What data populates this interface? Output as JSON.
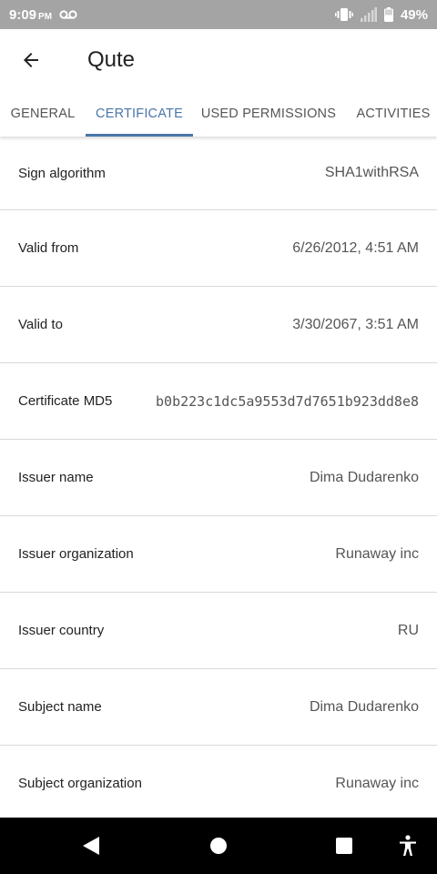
{
  "status_bar": {
    "time": "9:09",
    "ampm": "PM",
    "battery": "49%",
    "icons": [
      "voicemail-icon",
      "vibrate-icon",
      "signal-icon",
      "battery-icon"
    ]
  },
  "app_bar": {
    "title": "Qute",
    "back_icon": "arrow-left-icon"
  },
  "tabs": [
    {
      "label": "GENERAL",
      "active": false
    },
    {
      "label": "CERTIFICATE",
      "active": true
    },
    {
      "label": "USED PERMISSIONS",
      "active": false
    },
    {
      "label": "ACTIVITIES",
      "active": false
    }
  ],
  "colors": {
    "accent": "#4a76a8",
    "status_bar": "#a4a4a4",
    "nav_bar": "#000000",
    "divider": "#d9d9d9"
  },
  "certificate": [
    {
      "label": "Sign algorithm",
      "value": "SHA1withRSA"
    },
    {
      "label": "Valid from",
      "value": "6/26/2012, 4:51 AM"
    },
    {
      "label": "Valid to",
      "value": "3/30/2067, 3:51 AM"
    },
    {
      "label": "Certificate MD5",
      "value": "b0b223c1dc5a9553d7d7651b923dd8e8"
    },
    {
      "label": "Issuer name",
      "value": "Dima Dudarenko"
    },
    {
      "label": "Issuer organization",
      "value": "Runaway inc"
    },
    {
      "label": "Issuer country",
      "value": "RU"
    },
    {
      "label": "Subject name",
      "value": "Dima Dudarenko"
    },
    {
      "label": "Subject organization",
      "value": "Runaway inc"
    }
  ],
  "nav_bar": {
    "icons": [
      "back-triangle-icon",
      "home-circle-icon",
      "recents-square-icon",
      "accessibility-icon"
    ]
  }
}
